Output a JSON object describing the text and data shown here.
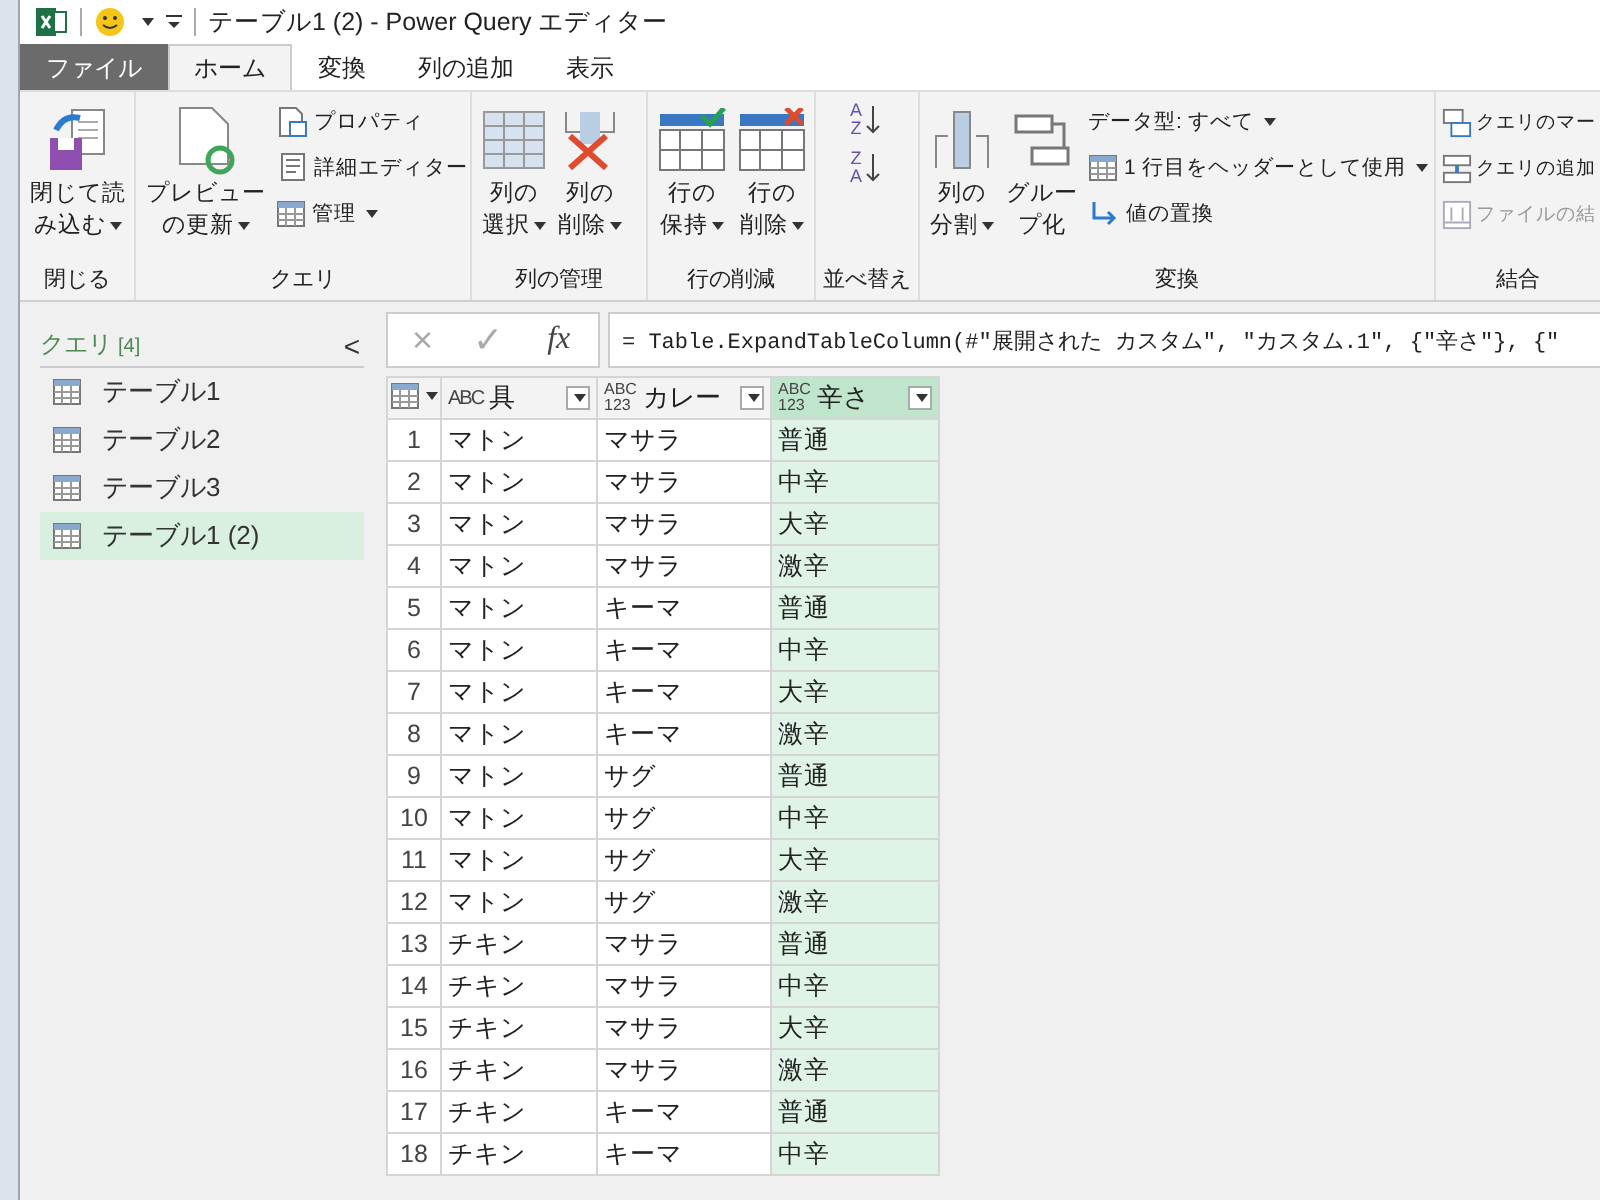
{
  "window": {
    "title": "テーブル1 (2) - Power Query エディター"
  },
  "tabs": [
    {
      "label": "ファイル",
      "kind": "file",
      "selected": false
    },
    {
      "label": "ホーム",
      "kind": "tab",
      "selected": true
    },
    {
      "label": "変換",
      "kind": "tab",
      "selected": false
    },
    {
      "label": "列の追加",
      "kind": "tab",
      "selected": false
    },
    {
      "label": "表示",
      "kind": "tab",
      "selected": false
    }
  ],
  "ribbon": [
    {
      "label": "閉じる",
      "items": [
        {
          "kind": "large",
          "lines": [
            "閉じて読",
            "み込む"
          ],
          "dropdown": true
        }
      ]
    },
    {
      "label": "クエリ",
      "items": [
        {
          "kind": "large",
          "lines": [
            "プレビュー",
            "の更新"
          ],
          "dropdown": true
        },
        {
          "kind": "stack",
          "entries": [
            {
              "label": "プロパティ",
              "dropdown": false,
              "disabled": false
            },
            {
              "label": "詳細エディター",
              "dropdown": false,
              "disabled": false
            },
            {
              "label": "管理",
              "dropdown": true,
              "disabled": false
            }
          ]
        }
      ]
    },
    {
      "label": "列の管理",
      "items": [
        {
          "kind": "large",
          "lines": [
            "列の",
            "選択"
          ],
          "dropdown": true
        },
        {
          "kind": "large",
          "lines": [
            "列の",
            "削除"
          ],
          "dropdown": true
        }
      ]
    },
    {
      "label": "行の削減",
      "items": [
        {
          "kind": "large",
          "lines": [
            "行の",
            "保持"
          ],
          "dropdown": true
        },
        {
          "kind": "large",
          "lines": [
            "行の",
            "削除"
          ],
          "dropdown": true
        }
      ]
    },
    {
      "label": "並べ替え",
      "items": [
        {
          "kind": "sort",
          "entries": [
            {
              "top": "A",
              "bottom": "Z"
            },
            {
              "top": "Z",
              "bottom": "A"
            }
          ]
        }
      ]
    },
    {
      "label": "変換",
      "items": [
        {
          "kind": "large",
          "lines": [
            "列の",
            "分割"
          ],
          "dropdown": true
        },
        {
          "kind": "large",
          "lines": [
            "グルー",
            "プ化"
          ],
          "dropdown": false
        },
        {
          "kind": "stack",
          "entries": [
            {
              "label": "データ型: すべて",
              "dropdown": true,
              "disabled": false
            },
            {
              "label": "1 行目をヘッダーとして使用",
              "dropdown": true,
              "disabled": false
            },
            {
              "label": "値の置換",
              "dropdown": false,
              "disabled": false
            }
          ]
        }
      ]
    },
    {
      "label": "結合",
      "items": [
        {
          "kind": "stack",
          "entries": [
            {
              "label": "クエリのマー",
              "dropdown": false,
              "disabled": false
            },
            {
              "label": "クエリの追加",
              "dropdown": false,
              "disabled": false
            },
            {
              "label": "ファイルの結",
              "dropdown": false,
              "disabled": true
            }
          ]
        }
      ]
    }
  ],
  "queries": {
    "title": "クエリ",
    "count": "[4]",
    "collapse": "<",
    "items": [
      {
        "label": "テーブル1",
        "selected": false
      },
      {
        "label": "テーブル2",
        "selected": false
      },
      {
        "label": "テーブル3",
        "selected": false
      },
      {
        "label": "テーブル1 (2)",
        "selected": true
      }
    ]
  },
  "formula_bar": {
    "cancel": "×",
    "confirm": "✓",
    "fx": "fx",
    "formula": "= Table.ExpandTableColumn(#\"展開された カスタム\", \"カスタム.1\", {\"辛さ\"}, {\""
  },
  "table": {
    "columns": [
      {
        "name": "具",
        "letters": "ABC",
        "selected": false
      },
      {
        "name": "カレー",
        "letters": "ABC",
        "digits": "123",
        "selected": false
      },
      {
        "name": "辛さ",
        "letters": "ABC",
        "digits": "123",
        "selected": true
      }
    ],
    "rows": [
      {
        "number": "1",
        "cells": [
          "マトン",
          "マサラ",
          "普通"
        ]
      },
      {
        "number": "2",
        "cells": [
          "マトン",
          "マサラ",
          "中辛"
        ]
      },
      {
        "number": "3",
        "cells": [
          "マトン",
          "マサラ",
          "大辛"
        ]
      },
      {
        "number": "4",
        "cells": [
          "マトン",
          "マサラ",
          "激辛"
        ]
      },
      {
        "number": "5",
        "cells": [
          "マトン",
          "キーマ",
          "普通"
        ]
      },
      {
        "number": "6",
        "cells": [
          "マトン",
          "キーマ",
          "中辛"
        ]
      },
      {
        "number": "7",
        "cells": [
          "マトン",
          "キーマ",
          "大辛"
        ]
      },
      {
        "number": "8",
        "cells": [
          "マトン",
          "キーマ",
          "激辛"
        ]
      },
      {
        "number": "9",
        "cells": [
          "マトン",
          "サグ",
          "普通"
        ]
      },
      {
        "number": "10",
        "cells": [
          "マトン",
          "サグ",
          "中辛"
        ]
      },
      {
        "number": "11",
        "cells": [
          "マトン",
          "サグ",
          "大辛"
        ]
      },
      {
        "number": "12",
        "cells": [
          "マトン",
          "サグ",
          "激辛"
        ]
      },
      {
        "number": "13",
        "cells": [
          "チキン",
          "マサラ",
          "普通"
        ]
      },
      {
        "number": "14",
        "cells": [
          "チキン",
          "マサラ",
          "中辛"
        ]
      },
      {
        "number": "15",
        "cells": [
          "チキン",
          "マサラ",
          "大辛"
        ]
      },
      {
        "number": "16",
        "cells": [
          "チキン",
          "マサラ",
          "激辛"
        ]
      },
      {
        "number": "17",
        "cells": [
          "チキン",
          "キーマ",
          "普通"
        ]
      },
      {
        "number": "18",
        "cells": [
          "チキン",
          "キーマ",
          "中辛"
        ]
      }
    ]
  }
}
